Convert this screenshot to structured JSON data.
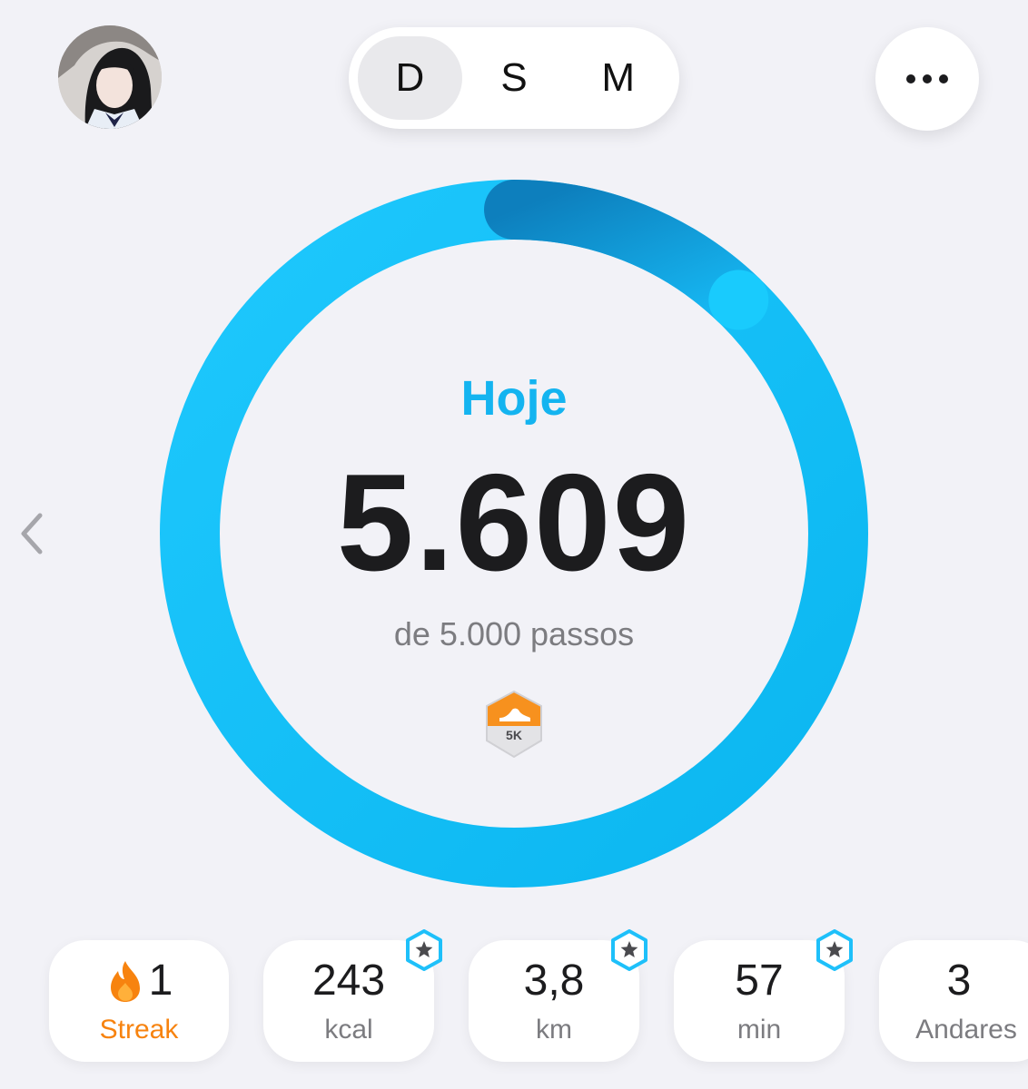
{
  "header": {
    "avatar_icon": "user-avatar",
    "period_options": [
      "D",
      "S",
      "M"
    ],
    "active_period": "D",
    "more_icon": "ellipsis-icon"
  },
  "ring": {
    "label": "Hoje",
    "steps": "5.609",
    "goal_text": "de 5.000 passos",
    "progress_fraction": 1.1218,
    "badge_text": "5K",
    "colors": {
      "ring_start": "#18c3fb",
      "ring_end": "#0eb8f2",
      "overlap": "#0e87c6",
      "label": "#14b4f0"
    }
  },
  "stats": {
    "streak": {
      "value": "1",
      "label": "Streak",
      "icon": "flame-icon",
      "color": "#f7830f"
    },
    "calories": {
      "value": "243",
      "label": "kcal",
      "badge": "star-badge"
    },
    "distance": {
      "value": "3,8",
      "label": "km",
      "badge": "star-badge"
    },
    "active_time": {
      "value": "57",
      "label": "min",
      "badge": "star-badge"
    },
    "floors": {
      "value": "3",
      "label": "Andares"
    }
  }
}
